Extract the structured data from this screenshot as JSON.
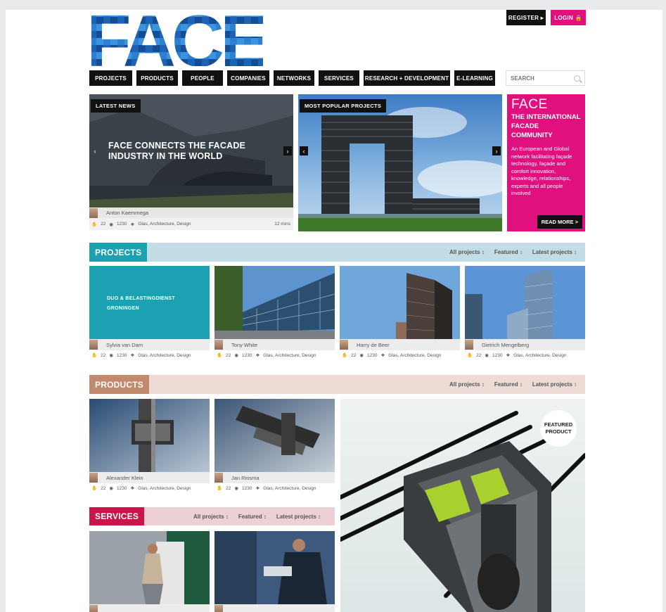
{
  "header": {
    "logo_text": "FACE",
    "register_label": "REGISTER ▸",
    "login_label": "LOGIN 🔒",
    "search_placeholder": "SEARCH",
    "nav": [
      "PROJECTS",
      "PRODUCTS",
      "PEOPLE",
      "COMPANIES",
      "NETWORKS",
      "SERVICES",
      "RESEARCH + DEVELOPMENT",
      "E-LEARNING"
    ]
  },
  "hero": {
    "news": {
      "tag": "LATEST NEWS",
      "title": "FACE CONNECTS THE FACADE INDUSTRY IN THE WORLD",
      "author": "Anton Kaemmega",
      "likes": "22",
      "views": "1230",
      "tags": "Glas, Architecture, Design",
      "time": "12 mins"
    },
    "popular": {
      "tag": "MOST POPULAR PROJECTS"
    },
    "face": {
      "brand": "FACE",
      "subtitle": "THE INTERNATIONAL FACADE COMMUNITY",
      "text": "An European and Global network facilitating façade technology, façade and comfort innovation, knowledge, relationships, experts and all people involved",
      "read_more": "READ MORE >"
    }
  },
  "filters": [
    "All projects",
    "Featured",
    "Latest projects"
  ],
  "projects": {
    "title": "PROJECTS",
    "items": [
      {
        "overlay": "DUO & BELASTINGDIENST GRONINGEN",
        "author": "Sylvia van Dam",
        "likes": "22",
        "views": "1230",
        "tags": "Glas, Architecture, Design"
      },
      {
        "author": "Tony White",
        "likes": "22",
        "views": "1230",
        "tags": "Glas, Architecture, Design"
      },
      {
        "author": "Harry de Beer",
        "likes": "22",
        "views": "1230",
        "tags": "Glas, Architecture, Design"
      },
      {
        "author": "Dietrich Mengelberg",
        "likes": "22",
        "views": "1230",
        "tags": "Glas, Architecture, Design"
      }
    ]
  },
  "products": {
    "title": "PRODUCTS",
    "featured_badge": "FEATURED PRODUCT",
    "items": [
      {
        "author": "Alexander Klein",
        "likes": "22",
        "views": "1230",
        "tags": "Glas, Architecture, Design"
      },
      {
        "author": "Jan Rinsma",
        "likes": "22",
        "views": "1230",
        "tags": "Glas, Architecture, Design"
      }
    ]
  },
  "services": {
    "title": "SERVICES"
  },
  "colors": {
    "accent": "#e0117f",
    "projects": "#1ca1b3",
    "products": "#c3896c",
    "services": "#c8164a"
  }
}
